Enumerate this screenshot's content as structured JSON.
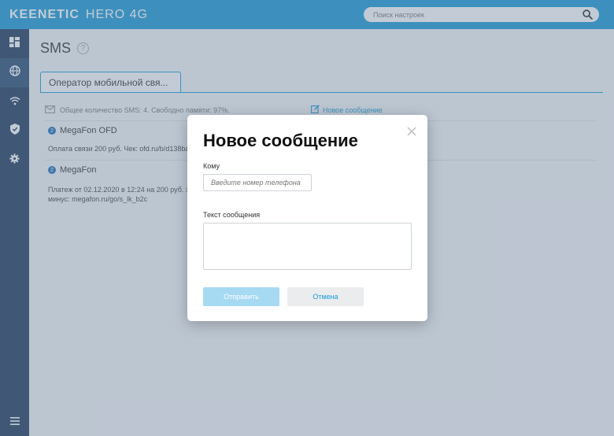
{
  "header": {
    "brand": "KEENETIC",
    "model": "HERO 4G",
    "search_placeholder": "Поиск настроек"
  },
  "sidebar": {
    "items": [
      {
        "icon": "dashboard-icon"
      },
      {
        "icon": "globe-icon",
        "active": true
      },
      {
        "icon": "wifi-icon"
      },
      {
        "icon": "shield-icon"
      },
      {
        "icon": "gear-icon"
      }
    ],
    "menu_icon": "hamburger-menu-icon"
  },
  "page": {
    "title": "SMS",
    "tab_label": "Оператор мобильной свя...",
    "info_text": "Общее количество SMS: 4. Свободно памяти: 97%.",
    "new_message_link": "Новое сообщение"
  },
  "messages": [
    {
      "count": "2",
      "sender": "MegaFon OFD",
      "body": "Оплата связи 200 руб. Чек: ofd.ru/b/d138ba1"
    },
    {
      "count": "2",
      "sender": "MegaFon",
      "body_line1": "Платеж от 02.12.2020 в 12:24 на 200 руб. зач",
      "body_line2": "минус: megafon.ru/go/s_lk_b2c"
    }
  ],
  "modal": {
    "title": "Новое сообщение",
    "to_label": "Кому",
    "phone_placeholder": "Введите номер телефона",
    "text_label": "Текст сообщения",
    "send_label": "Отправить",
    "cancel_label": "Отмена"
  },
  "colors": {
    "accent": "#1a9ad6",
    "sidebar": "#1f3a5a",
    "send_disabled": "#a6d9f2"
  }
}
